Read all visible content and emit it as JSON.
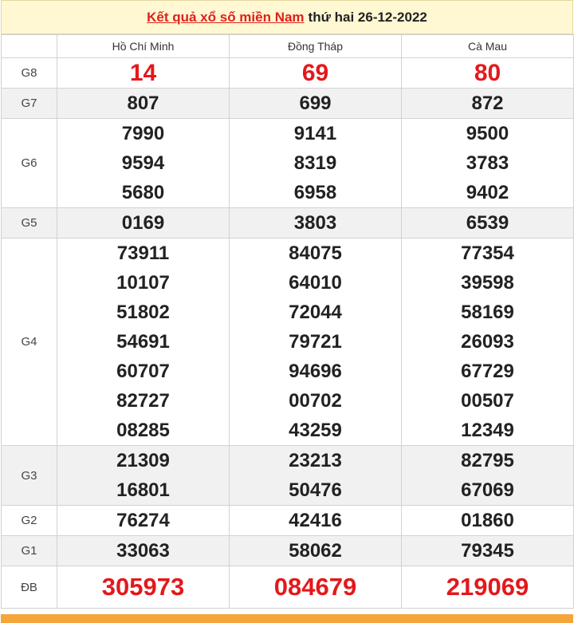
{
  "header": {
    "link_text": "Kết quả xổ số miền Nam",
    "date_text": "thứ hai 26-12-2022"
  },
  "provinces": [
    "Hồ Chí Minh",
    "Đồng Tháp",
    "Cà Mau"
  ],
  "prizes": [
    {
      "label": "G8",
      "values": [
        [
          "14"
        ],
        [
          "69"
        ],
        [
          "80"
        ]
      ]
    },
    {
      "label": "G7",
      "values": [
        [
          "807"
        ],
        [
          "699"
        ],
        [
          "872"
        ]
      ]
    },
    {
      "label": "G6",
      "values": [
        [
          "7990",
          "9594",
          "5680"
        ],
        [
          "9141",
          "8319",
          "6958"
        ],
        [
          "9500",
          "3783",
          "9402"
        ]
      ]
    },
    {
      "label": "G5",
      "values": [
        [
          "0169"
        ],
        [
          "3803"
        ],
        [
          "6539"
        ]
      ]
    },
    {
      "label": "G4",
      "values": [
        [
          "73911",
          "10107",
          "51802",
          "54691",
          "60707",
          "82727",
          "08285"
        ],
        [
          "84075",
          "64010",
          "72044",
          "79721",
          "94696",
          "00702",
          "43259"
        ],
        [
          "77354",
          "39598",
          "58169",
          "26093",
          "67729",
          "00507",
          "12349"
        ]
      ]
    },
    {
      "label": "G3",
      "values": [
        [
          "21309",
          "16801"
        ],
        [
          "23213",
          "50476"
        ],
        [
          "82795",
          "67069"
        ]
      ]
    },
    {
      "label": "G2",
      "values": [
        [
          "76274"
        ],
        [
          "42416"
        ],
        [
          "01860"
        ]
      ]
    },
    {
      "label": "G1",
      "values": [
        [
          "33063"
        ],
        [
          "58062"
        ],
        [
          "79345"
        ]
      ]
    },
    {
      "label": "ĐB",
      "values": [
        [
          "305973"
        ],
        [
          "084679"
        ],
        [
          "219069"
        ]
      ]
    }
  ],
  "colors": {
    "accent_red": "#e4181c",
    "header_bg": "#fff8d2",
    "alt_row_bg": "#f1f1f1",
    "bottom_stripe": "#f6a53a"
  }
}
